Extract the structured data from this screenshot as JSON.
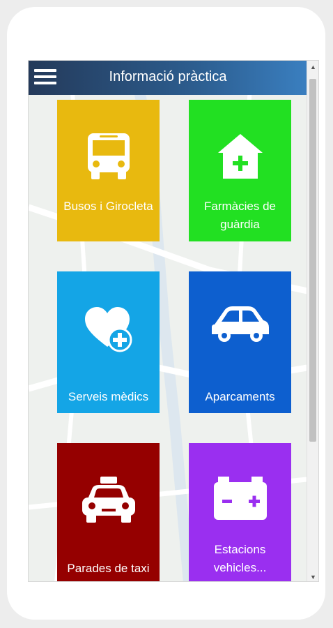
{
  "header": {
    "title": "Informació pràctica",
    "menu_icon": "hamburger-menu-icon"
  },
  "colors": {
    "bus": "#e8b90f",
    "pharmacy": "#22e022",
    "medical": "#14a5e6",
    "parking": "#0d5fcf",
    "taxi": "#950000",
    "charging": "#9a2ff0"
  },
  "tiles": [
    {
      "label": "Busos i Girocleta",
      "icon": "bus-icon"
    },
    {
      "label": "Farmàcies de guàrdia",
      "icon": "pharmacy-house-icon"
    },
    {
      "label": "Serveis mèdics",
      "icon": "heart-plus-icon"
    },
    {
      "label": "Aparcaments",
      "icon": "car-icon"
    },
    {
      "label": "Parades de taxi",
      "icon": "taxi-icon"
    },
    {
      "label": "Estacions vehicles...",
      "icon": "battery-icon"
    }
  ]
}
